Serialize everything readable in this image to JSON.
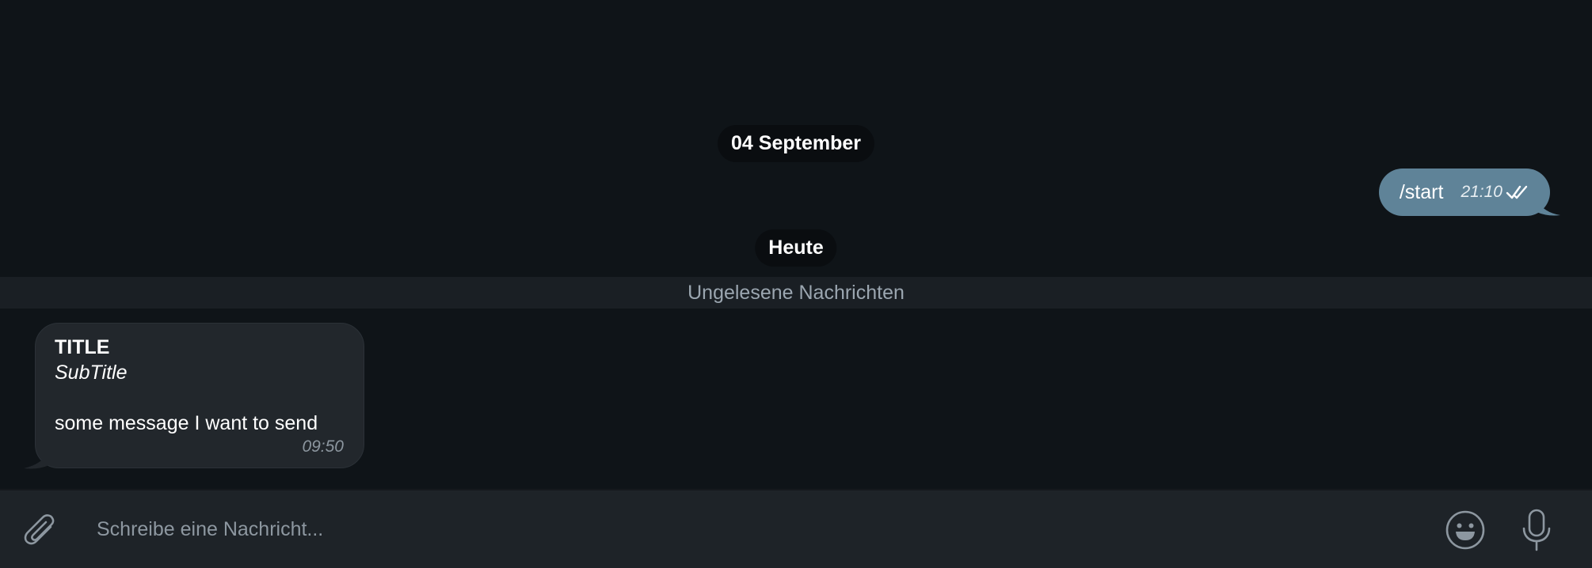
{
  "chat": {
    "date_separators": [
      "04 September",
      "Heute"
    ],
    "unread_label": "Ungelesene Nachrichten",
    "outgoing": {
      "text": "/start",
      "time": "21:10",
      "status_icon": "double-check-icon",
      "bubble_color": "#5f8398"
    },
    "incoming": {
      "title": "TITLE",
      "subtitle": "SubTitle",
      "message": "some message I want to send",
      "time": "09:50",
      "bubble_color": "#22272c"
    }
  },
  "composer": {
    "placeholder": "Schreibe eine Nachricht...",
    "attach_icon": "paperclip-icon",
    "emoji_icon": "smiley-icon",
    "mic_icon": "microphone-icon"
  },
  "colors": {
    "background": "#0f1418",
    "composer_background": "#1e2328"
  }
}
